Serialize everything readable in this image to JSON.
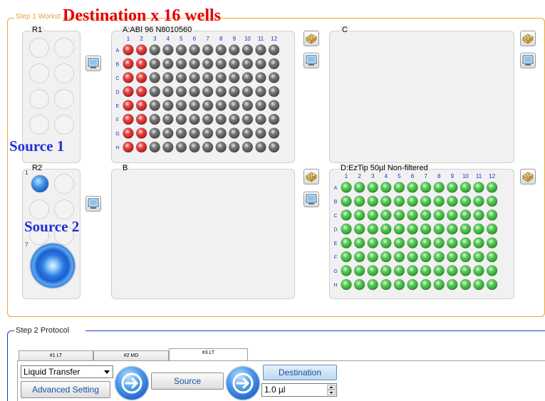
{
  "workstation": {
    "legend": "Step 1 Workst",
    "overlay_title": "Destination x 16 wells",
    "border_color": "#f0a23a"
  },
  "annotations": {
    "source1": "Source 1",
    "source2": "Source 2",
    "color": "#1d2fd6",
    "title_color": "#e60000"
  },
  "racks": {
    "r1": {
      "title": "R1"
    },
    "r2": {
      "title": "R2",
      "position_1": "1",
      "position_7": "7"
    }
  },
  "plates": {
    "a": {
      "title": "A:ABI 96 N8010560",
      "columns": [
        "1",
        "2",
        "3",
        "4",
        "5",
        "6",
        "7",
        "8",
        "9",
        "10",
        "11",
        "12"
      ],
      "rows": [
        "A",
        "B",
        "C",
        "D",
        "E",
        "F",
        "G",
        "H"
      ],
      "highlighted_columns": 2,
      "highlight_color": "#e21b1b",
      "well_color": "#5a5a5a"
    },
    "b": {
      "title": "B"
    },
    "c": {
      "title": "C"
    },
    "d": {
      "title": "D:EzTip 50µl Non-filtered",
      "columns": [
        "1",
        "2",
        "3",
        "4",
        "5",
        "6",
        "7",
        "8",
        "9",
        "10",
        "11",
        "12"
      ],
      "rows": [
        "A",
        "B",
        "C",
        "D",
        "E",
        "F",
        "G",
        "H"
      ],
      "well_color": "#2fc02f"
    }
  },
  "protocol": {
    "legend": "Step 2 Protocol",
    "tabs": [
      "#1 LT",
      "#2 MD",
      "#3 LT"
    ],
    "active_tab": 2,
    "operation_select": "Liquid Transfer",
    "advanced_setting": "Advanced Setting",
    "source_button": "Source",
    "destination_button": "Destination",
    "volume": "1.0 µl"
  }
}
